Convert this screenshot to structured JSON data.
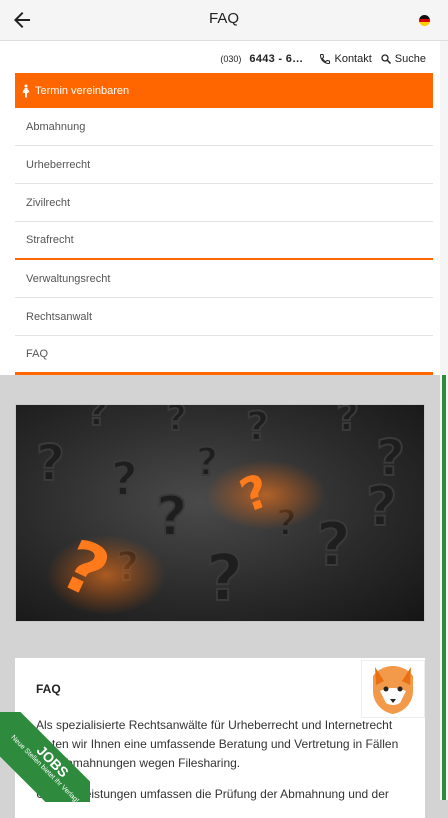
{
  "appbar": {
    "title": "FAQ",
    "back_icon": "arrow-left-icon",
    "language_icon": "german-flag-icon"
  },
  "topline": {
    "phone_prefix": "(030)",
    "phone_number": "6443 - 6…",
    "contact_label": "Kontakt",
    "search_label": "Suche"
  },
  "cta": {
    "label": "Termin vereinbaren",
    "icon": "person-walking-icon"
  },
  "menu": {
    "items": [
      {
        "label": "Abmahnung"
      },
      {
        "label": "Urheberrecht"
      },
      {
        "label": "Zivilrecht"
      },
      {
        "label": "Strafrecht"
      },
      {
        "label": "Verwaltungsrecht"
      },
      {
        "label": "Rechtsanwalt"
      },
      {
        "label": "FAQ"
      }
    ]
  },
  "card": {
    "title": "FAQ",
    "paragraph1": "Als spezialisierte Rechtsanwälte für Urheberrecht und Internetrecht bieten wir Ihnen eine umfassende Beratung und Vertretung in Fällen von Abmahnungen wegen Filesharing.",
    "paragraph2": "Unsere Leistungen umfassen die Prüfung der Abmahnung und der"
  },
  "jobs_badge": {
    "title": "JOBS",
    "subtitle": "Neue Stellen bietet ihr Verlag!"
  },
  "colors": {
    "accent": "#ff6600",
    "scroll": "#2e8b3e"
  }
}
